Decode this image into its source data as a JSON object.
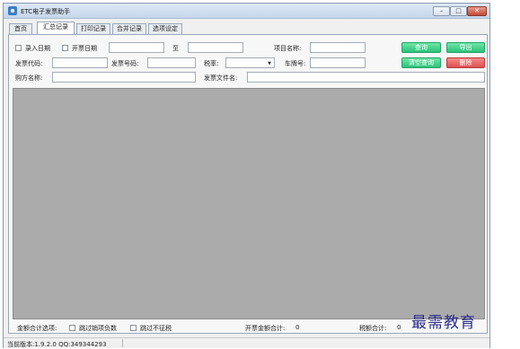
{
  "window": {
    "title": "ETC电子发票助手",
    "controls": {
      "minimize": "–",
      "maximize": "□",
      "close": "✕"
    }
  },
  "tabs": [
    {
      "label": "首页",
      "active": false
    },
    {
      "label": "汇总记录",
      "active": true
    },
    {
      "label": "打印记录",
      "active": false
    },
    {
      "label": "合并记录",
      "active": false
    },
    {
      "label": "选项设定",
      "active": false
    }
  ],
  "filters": {
    "entry_date_label": "录入日期",
    "invoice_date_label": "开票日期",
    "date_from": "",
    "to_label": "至",
    "date_to": "",
    "project_name_label": "项目名称:",
    "project_name": "",
    "invoice_code_label": "发票代码:",
    "invoice_code": "",
    "invoice_number_label": "发票号码:",
    "invoice_number": "",
    "tax_rate_label": "税率:",
    "tax_rate": "",
    "plate_label": "车牌号:",
    "plate": "",
    "buyer_label": "购方名称:",
    "buyer": "",
    "invoice_file_label": "发票文件名:",
    "invoice_file": ""
  },
  "buttons": {
    "query": "查询",
    "export": "导出",
    "clear_query": "清空查询",
    "delete": "删除"
  },
  "footer": {
    "amount_options_label": "金额合计选项:",
    "skip_sales_negative_label": "跳过销项负数",
    "skip_no_tax_label": "跳过不征税",
    "invoice_total_label": "开票金额合计:",
    "invoice_total": "0",
    "tax_total_label": "税额合计:",
    "tax_total": "0"
  },
  "status": {
    "version_text": "当前版本:1.9.2.0  QQ:349344293"
  },
  "watermark": "最需教育",
  "colors": {
    "green_button": "#2cc27b",
    "red_button": "#e04f4f",
    "grid_background": "#ababab"
  }
}
